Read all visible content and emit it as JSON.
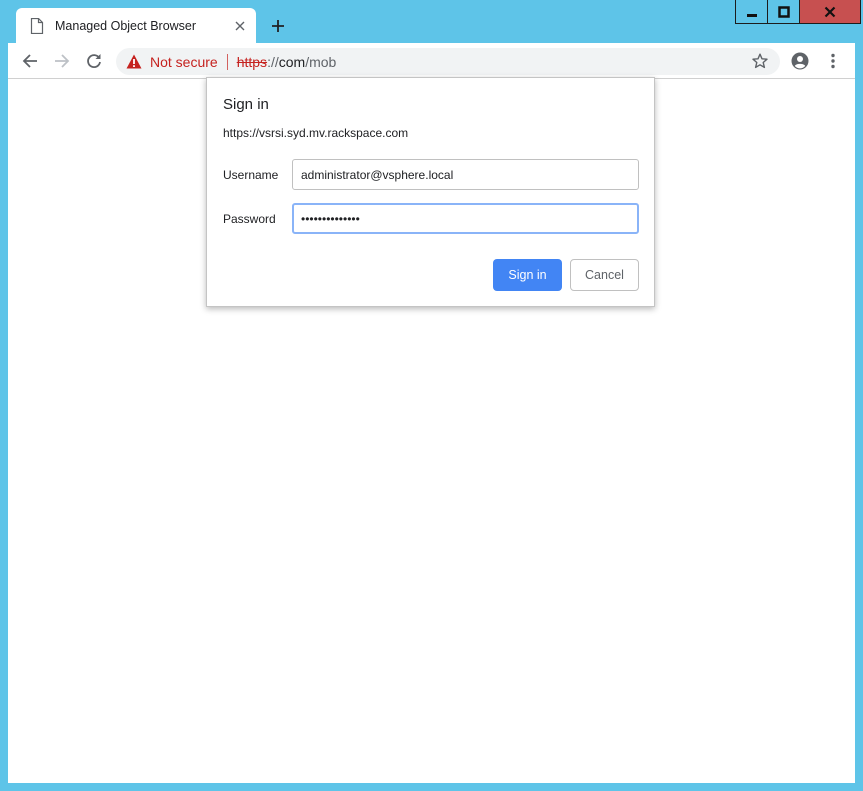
{
  "tab": {
    "title": "Managed Object Browser"
  },
  "omnibox": {
    "security_label": "Not secure",
    "url_scheme": "https",
    "url_sep": "://",
    "url_host": "com",
    "url_path": "/mob"
  },
  "dialog": {
    "title": "Sign in",
    "origin": "https://vsrsi.syd.mv.rackspace.com",
    "username_label": "Username",
    "username_value": "administrator@vsphere.local",
    "password_label": "Password",
    "password_value": "••••••••••••••",
    "signin_label": "Sign in",
    "cancel_label": "Cancel"
  },
  "icons": {
    "tab_icon": "document-icon",
    "security_icon": "warning-triangle-icon",
    "bookmark": "star-icon",
    "profile": "account-circle-icon",
    "menu": "three-dots-icon"
  },
  "colors": {
    "window_frame": "#5ec4e8",
    "close_button": "#c75050",
    "warning": "#c5221f",
    "primary_button": "#4285f4",
    "focus_ring": "#8ab4f8"
  }
}
